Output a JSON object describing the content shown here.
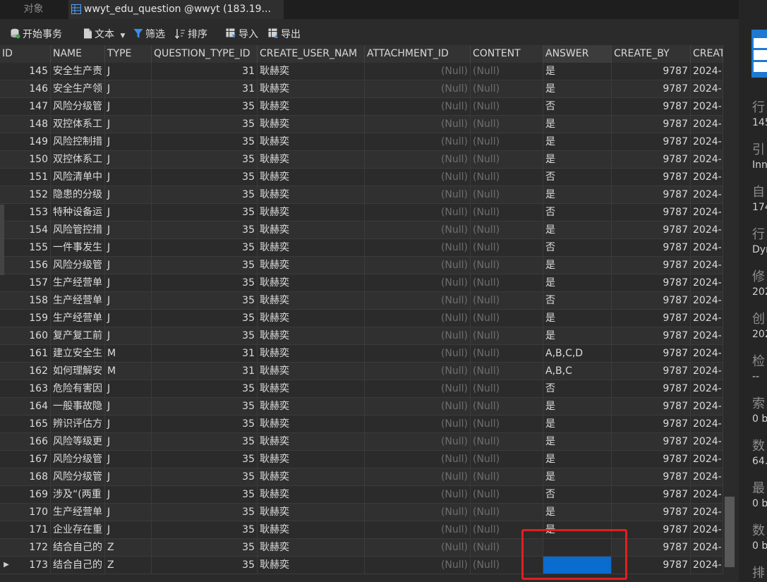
{
  "tabs": {
    "objects": "对象",
    "active": "wwyt_edu_question @wwyt (183.19..."
  },
  "toolbar": {
    "begin_transaction": "开始事务",
    "text": "文本",
    "filter": "筛选",
    "sort": "排序",
    "import": "导入",
    "export": "导出"
  },
  "columns": [
    "ID",
    "NAME",
    "TYPE",
    "QUESTION_TYPE_ID",
    "CREATE_USER_NAM",
    "ATTACHMENT_ID",
    "CONTENT",
    "ANSWER",
    "CREATE_BY",
    "CREAT"
  ],
  "rows": [
    {
      "id": "145",
      "name": "安全生产责",
      "type": "J",
      "qtid": "31",
      "user": "耿赫奕",
      "attachment": "(Null)",
      "content": "(Null)",
      "answer": "是",
      "create_by": "9787",
      "created": "2024-"
    },
    {
      "id": "146",
      "name": "安全生产领",
      "type": "J",
      "qtid": "31",
      "user": "耿赫奕",
      "attachment": "(Null)",
      "content": "(Null)",
      "answer": "是",
      "create_by": "9787",
      "created": "2024-"
    },
    {
      "id": "147",
      "name": "风险分级管",
      "type": "J",
      "qtid": "35",
      "user": "耿赫奕",
      "attachment": "(Null)",
      "content": "(Null)",
      "answer": "否",
      "create_by": "9787",
      "created": "2024-"
    },
    {
      "id": "148",
      "name": "双控体系工",
      "type": "J",
      "qtid": "35",
      "user": "耿赫奕",
      "attachment": "(Null)",
      "content": "(Null)",
      "answer": "是",
      "create_by": "9787",
      "created": "2024-"
    },
    {
      "id": "149",
      "name": "风险控制措",
      "type": "J",
      "qtid": "35",
      "user": "耿赫奕",
      "attachment": "(Null)",
      "content": "(Null)",
      "answer": "是",
      "create_by": "9787",
      "created": "2024-"
    },
    {
      "id": "150",
      "name": "双控体系工",
      "type": "J",
      "qtid": "35",
      "user": "耿赫奕",
      "attachment": "(Null)",
      "content": "(Null)",
      "answer": "是",
      "create_by": "9787",
      "created": "2024-"
    },
    {
      "id": "151",
      "name": "风险清单中",
      "type": "J",
      "qtid": "35",
      "user": "耿赫奕",
      "attachment": "(Null)",
      "content": "(Null)",
      "answer": "否",
      "create_by": "9787",
      "created": "2024-"
    },
    {
      "id": "152",
      "name": "隐患的分级",
      "type": "J",
      "qtid": "35",
      "user": "耿赫奕",
      "attachment": "(Null)",
      "content": "(Null)",
      "answer": "是",
      "create_by": "9787",
      "created": "2024-"
    },
    {
      "id": "153",
      "name": "特种设备运",
      "type": "J",
      "qtid": "35",
      "user": "耿赫奕",
      "attachment": "(Null)",
      "content": "(Null)",
      "answer": "否",
      "create_by": "9787",
      "created": "2024-"
    },
    {
      "id": "154",
      "name": "风险管控措",
      "type": "J",
      "qtid": "35",
      "user": "耿赫奕",
      "attachment": "(Null)",
      "content": "(Null)",
      "answer": "是",
      "create_by": "9787",
      "created": "2024-"
    },
    {
      "id": "155",
      "name": "一件事发生",
      "type": "J",
      "qtid": "35",
      "user": "耿赫奕",
      "attachment": "(Null)",
      "content": "(Null)",
      "answer": "否",
      "create_by": "9787",
      "created": "2024-"
    },
    {
      "id": "156",
      "name": "风险分级管",
      "type": "J",
      "qtid": "35",
      "user": "耿赫奕",
      "attachment": "(Null)",
      "content": "(Null)",
      "answer": "是",
      "create_by": "9787",
      "created": "2024-"
    },
    {
      "id": "157",
      "name": "生产经营单",
      "type": "J",
      "qtid": "35",
      "user": "耿赫奕",
      "attachment": "(Null)",
      "content": "(Null)",
      "answer": "是",
      "create_by": "9787",
      "created": "2024-"
    },
    {
      "id": "158",
      "name": "生产经营单",
      "type": "J",
      "qtid": "35",
      "user": "耿赫奕",
      "attachment": "(Null)",
      "content": "(Null)",
      "answer": "否",
      "create_by": "9787",
      "created": "2024-"
    },
    {
      "id": "159",
      "name": "生产经营单",
      "type": "J",
      "qtid": "35",
      "user": "耿赫奕",
      "attachment": "(Null)",
      "content": "(Null)",
      "answer": "是",
      "create_by": "9787",
      "created": "2024-"
    },
    {
      "id": "160",
      "name": "复产复工前",
      "type": "J",
      "qtid": "35",
      "user": "耿赫奕",
      "attachment": "(Null)",
      "content": "(Null)",
      "answer": "是",
      "create_by": "9787",
      "created": "2024-"
    },
    {
      "id": "161",
      "name": "建立安全生",
      "type": "M",
      "qtid": "31",
      "user": "耿赫奕",
      "attachment": "(Null)",
      "content": "(Null)",
      "answer": "A,B,C,D",
      "create_by": "9787",
      "created": "2024-"
    },
    {
      "id": "162",
      "name": "如何理解安",
      "type": "M",
      "qtid": "31",
      "user": "耿赫奕",
      "attachment": "(Null)",
      "content": "(Null)",
      "answer": "A,B,C",
      "create_by": "9787",
      "created": "2024-"
    },
    {
      "id": "163",
      "name": "危险有害因",
      "type": "J",
      "qtid": "35",
      "user": "耿赫奕",
      "attachment": "(Null)",
      "content": "(Null)",
      "answer": "否",
      "create_by": "9787",
      "created": "2024-"
    },
    {
      "id": "164",
      "name": "一般事故隐",
      "type": "J",
      "qtid": "35",
      "user": "耿赫奕",
      "attachment": "(Null)",
      "content": "(Null)",
      "answer": "是",
      "create_by": "9787",
      "created": "2024-"
    },
    {
      "id": "165",
      "name": "辨识评估方",
      "type": "J",
      "qtid": "35",
      "user": "耿赫奕",
      "attachment": "(Null)",
      "content": "(Null)",
      "answer": "是",
      "create_by": "9787",
      "created": "2024-"
    },
    {
      "id": "166",
      "name": "风险等级更",
      "type": "J",
      "qtid": "35",
      "user": "耿赫奕",
      "attachment": "(Null)",
      "content": "(Null)",
      "answer": "是",
      "create_by": "9787",
      "created": "2024-"
    },
    {
      "id": "167",
      "name": "风险分级管",
      "type": "J",
      "qtid": "35",
      "user": "耿赫奕",
      "attachment": "(Null)",
      "content": "(Null)",
      "answer": "是",
      "create_by": "9787",
      "created": "2024-"
    },
    {
      "id": "168",
      "name": "风险分级管",
      "type": "J",
      "qtid": "35",
      "user": "耿赫奕",
      "attachment": "(Null)",
      "content": "(Null)",
      "answer": "是",
      "create_by": "9787",
      "created": "2024-"
    },
    {
      "id": "169",
      "name": "涉及“(两重",
      "type": "J",
      "qtid": "35",
      "user": "耿赫奕",
      "attachment": "(Null)",
      "content": "(Null)",
      "answer": "否",
      "create_by": "9787",
      "created": "2024-"
    },
    {
      "id": "170",
      "name": "生产经营单",
      "type": "J",
      "qtid": "35",
      "user": "耿赫奕",
      "attachment": "(Null)",
      "content": "(Null)",
      "answer": "是",
      "create_by": "9787",
      "created": "2024-"
    },
    {
      "id": "171",
      "name": "企业存在重",
      "type": "J",
      "qtid": "35",
      "user": "耿赫奕",
      "attachment": "(Null)",
      "content": "(Null)",
      "answer": "是",
      "create_by": "9787",
      "created": "2024-"
    },
    {
      "id": "172",
      "name": "结合自己的",
      "type": "Z",
      "qtid": "35",
      "user": "耿赫奕",
      "attachment": "(Null)",
      "content": "(Null)",
      "answer": "",
      "create_by": "9787",
      "created": "2024-"
    },
    {
      "id": "173",
      "name": "结合自己的",
      "type": "Z",
      "qtid": "35",
      "user": "耿赫奕",
      "attachment": "(Null)",
      "content": "(Null)",
      "answer": "",
      "create_by": "9787",
      "created": "2024-",
      "current": true
    }
  ],
  "right_panel": [
    {
      "label": "行",
      "value": "145"
    },
    {
      "label": "引",
      "value": "Inn"
    },
    {
      "label": "自",
      "value": "174"
    },
    {
      "label": "行",
      "value": "Dyn"
    },
    {
      "label": "修",
      "value": "202"
    },
    {
      "label": "创",
      "value": "202"
    },
    {
      "label": "检",
      "value": "--"
    },
    {
      "label": "索",
      "value": "0 b"
    },
    {
      "label": "数",
      "value": "64."
    },
    {
      "label": "最",
      "value": "0 b"
    },
    {
      "label": "数",
      "value": "0 b"
    },
    {
      "label": "排",
      "value": ""
    }
  ],
  "colors": {
    "selected_cell": "#0a6ccf",
    "annotation": "#e02020",
    "null_text": "#6e6e6e"
  }
}
